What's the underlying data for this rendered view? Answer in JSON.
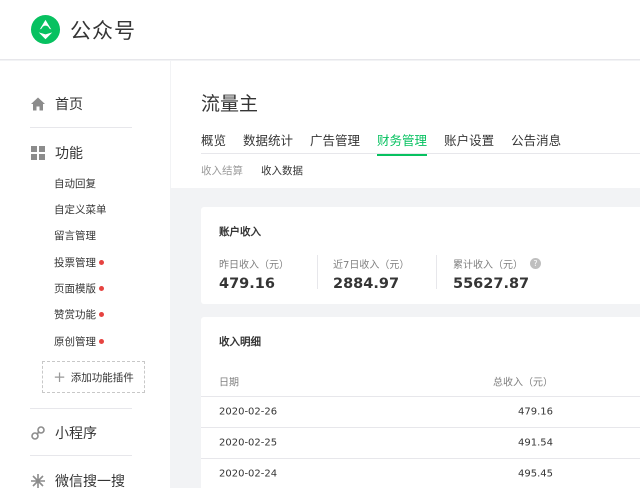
{
  "app": {
    "title": "公众号",
    "brand_color": "#07c160"
  },
  "sidebar": {
    "home": {
      "label": "首页",
      "icon": "home-icon"
    },
    "features": {
      "label": "功能",
      "icon": "grid-icon",
      "items": [
        {
          "label": "自动回复",
          "badge": false
        },
        {
          "label": "自定义菜单",
          "badge": false
        },
        {
          "label": "留言管理",
          "badge": false
        },
        {
          "label": "投票管理",
          "badge": true
        },
        {
          "label": "页面模版",
          "badge": true
        },
        {
          "label": "赞赏功能",
          "badge": true
        },
        {
          "label": "原创管理",
          "badge": true
        }
      ],
      "add_plugin": "添加功能插件"
    },
    "miniprogram": {
      "label": "小程序",
      "icon": "link-icon"
    },
    "search": {
      "label": "微信搜一搜",
      "icon": "sparkle-icon"
    }
  },
  "main": {
    "title": "流量主",
    "tabs": [
      "概览",
      "数据统计",
      "广告管理",
      "财务管理",
      "账户设置",
      "公告消息"
    ],
    "active_tab": "财务管理",
    "subtabs": [
      "收入结算",
      "收入数据"
    ],
    "active_subtab": "收入数据",
    "account": {
      "title": "账户收入",
      "stats": [
        {
          "label": "昨日收入（元）",
          "value": "479.16"
        },
        {
          "label": "近7日收入（元）",
          "value": "2884.97"
        },
        {
          "label": "累计收入（元）",
          "value": "55627.87",
          "help": "?"
        }
      ]
    },
    "detail": {
      "title": "收入明细",
      "columns": [
        "日期",
        "总收入（元）"
      ],
      "rows": [
        [
          "2020-02-26",
          "479.16"
        ],
        [
          "2020-02-25",
          "491.54"
        ],
        [
          "2020-02-24",
          "495.45"
        ]
      ]
    }
  }
}
